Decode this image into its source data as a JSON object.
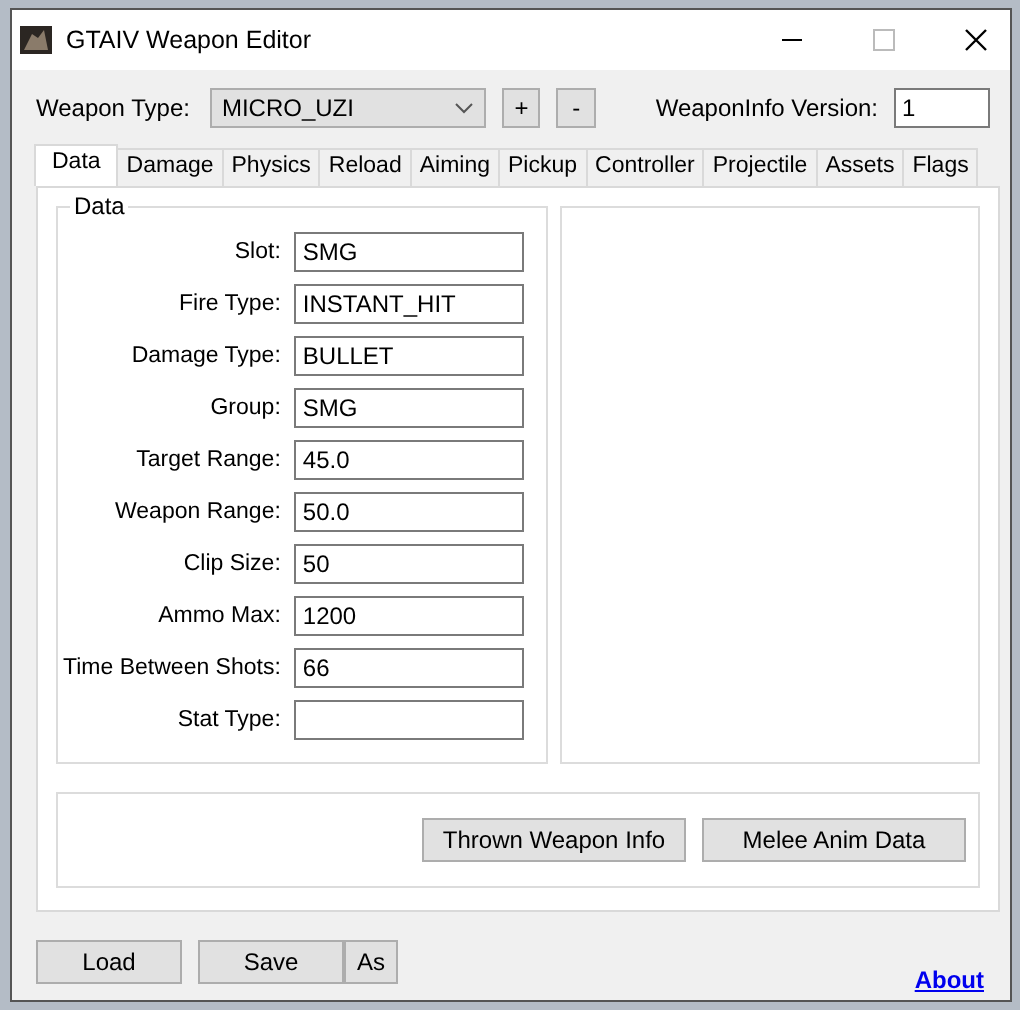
{
  "window": {
    "title": "GTAIV Weapon Editor"
  },
  "weapon_type": {
    "label": "Weapon Type:",
    "value": "MICRO_UZI"
  },
  "add_button": "+",
  "remove_button": "-",
  "version": {
    "label": "WeaponInfo Version:",
    "value": "1"
  },
  "tabs": [
    {
      "label": "Data",
      "selected": true
    },
    {
      "label": "Damage",
      "selected": false
    },
    {
      "label": "Physics",
      "selected": false
    },
    {
      "label": "Reload",
      "selected": false
    },
    {
      "label": "Aiming",
      "selected": false
    },
    {
      "label": "Pickup",
      "selected": false
    },
    {
      "label": "Controller",
      "selected": false
    },
    {
      "label": "Projectile",
      "selected": false
    },
    {
      "label": "Assets",
      "selected": false
    },
    {
      "label": "Flags",
      "selected": false
    }
  ],
  "data_group": {
    "title": "Data",
    "fields": [
      {
        "label": "Slot:",
        "value": "SMG"
      },
      {
        "label": "Fire Type:",
        "value": "INSTANT_HIT"
      },
      {
        "label": "Damage Type:",
        "value": "BULLET"
      },
      {
        "label": "Group:",
        "value": "SMG"
      },
      {
        "label": "Target Range:",
        "value": "45.0"
      },
      {
        "label": "Weapon Range:",
        "value": "50.0"
      },
      {
        "label": "Clip Size:",
        "value": "50"
      },
      {
        "label": "Ammo Max:",
        "value": "1200"
      },
      {
        "label": "Time Between Shots:",
        "value": "66"
      },
      {
        "label": "Stat Type:"
      }
    ]
  },
  "panel_buttons": [
    "Thrown Weapon Info",
    "Melee Anim Data"
  ],
  "footer": {
    "load": "Load",
    "save": "Save",
    "save_as": "As",
    "about": "About"
  }
}
